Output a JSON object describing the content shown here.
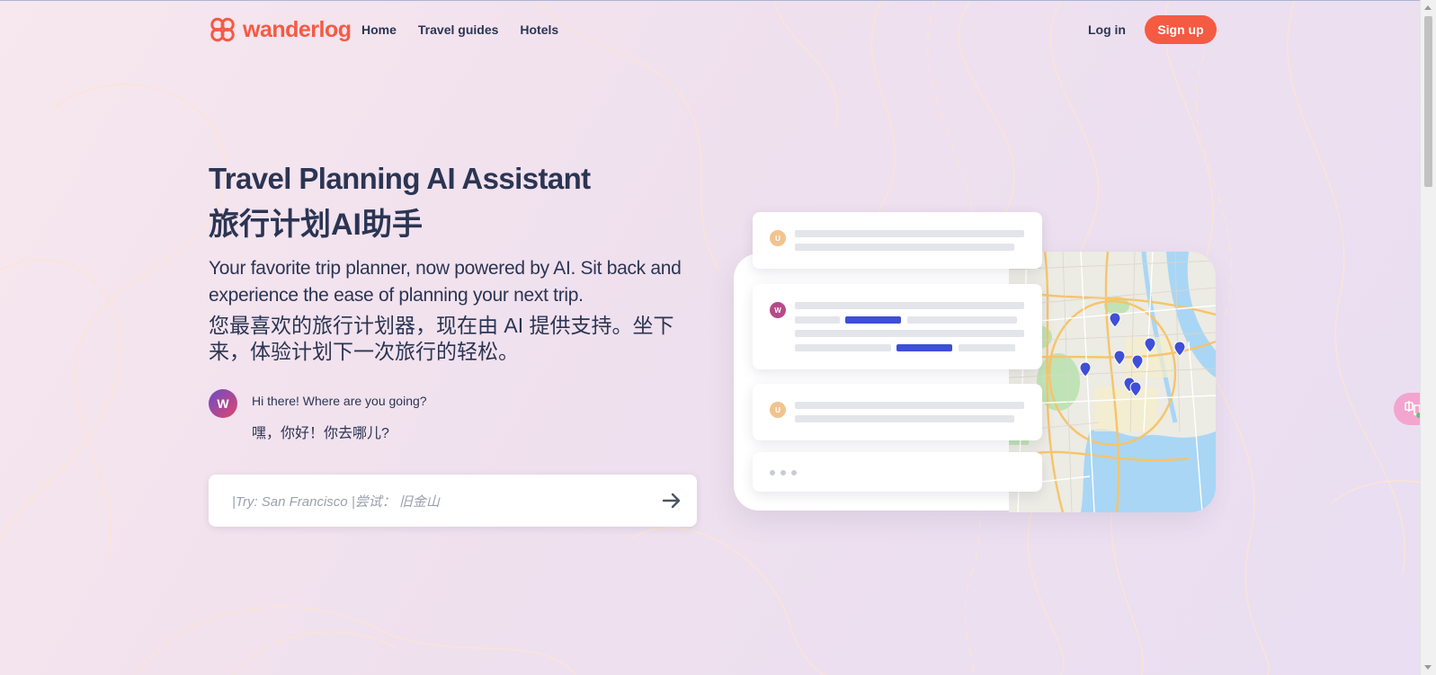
{
  "brand": {
    "name": "wanderlog",
    "color": "#f55a43"
  },
  "nav": {
    "links": [
      "Home",
      "Travel guides",
      "Hotels"
    ],
    "login": "Log in",
    "signup": "Sign up"
  },
  "hero": {
    "title_en": "Travel Planning AI Assistant",
    "title_zh": "旅行计划AI助手",
    "subtitle_en": "Your favorite trip planner, now powered by AI. Sit back and experience the ease of planning your next trip.",
    "subtitle_zh": "您最喜欢的旅行计划器，现在由 AI 提供支持。坐下来，体验计划下一次旅行的轻松。"
  },
  "chat": {
    "bot_initial": "W",
    "greeting_en": "Hi there! Where are you going?",
    "greeting_zh": "嘿，你好！你去哪儿?"
  },
  "search": {
    "placeholder": "|Try: San Francisco |尝试： 旧金山",
    "submit_icon": "arrow-right-icon"
  },
  "illustration": {
    "user_initial": "U",
    "assistant_initial": "W",
    "accent_color": "#3e4fd8",
    "user_color": "#f1c48f",
    "assistant_color": "#b64a8a"
  },
  "widget": {
    "icon": "translate-icon"
  }
}
